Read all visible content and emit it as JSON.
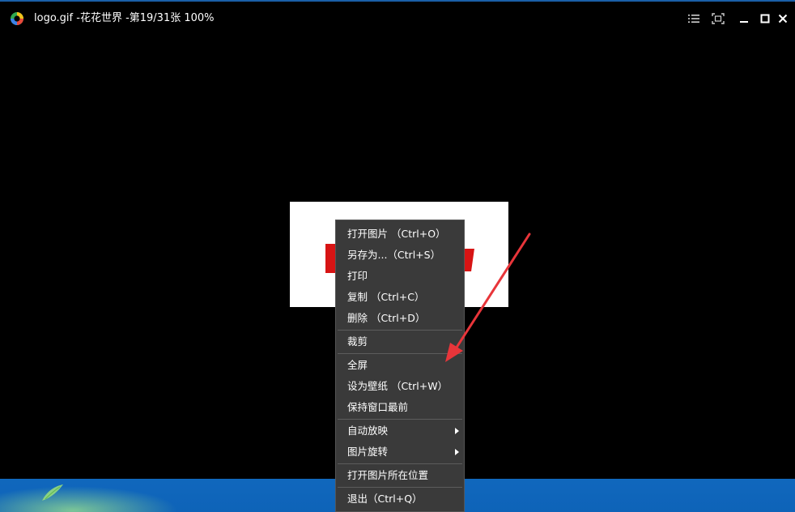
{
  "window": {
    "title": "logo.gif -花花世界 -第19/31张 100%"
  },
  "titlebar_buttons": [
    {
      "name": "menu-list-button",
      "icon": "list-icon"
    },
    {
      "name": "fit-screen-button",
      "icon": "fit-screen-icon"
    },
    {
      "name": "minimize-button",
      "icon": "minimize-icon"
    },
    {
      "name": "maximize-button",
      "icon": "maximize-icon"
    },
    {
      "name": "close-button",
      "icon": "close-icon"
    }
  ],
  "context_menu": {
    "items": [
      {
        "label": "打开图片 （Ctrl+O）"
      },
      {
        "label": "另存为...（Ctrl+S）"
      },
      {
        "label": "打印"
      },
      {
        "label": "复制 （Ctrl+C）"
      },
      {
        "label": "删除 （Ctrl+D）"
      },
      {
        "label": "裁剪"
      },
      {
        "label": "全屏"
      },
      {
        "label": "设为壁纸 （Ctrl+W）"
      },
      {
        "label": "保持窗口最前"
      },
      {
        "label": "自动放映"
      },
      {
        "label": "图片旋转"
      },
      {
        "label": "打开图片所在位置"
      },
      {
        "label": "退出（Ctrl+Q）"
      }
    ]
  },
  "colors": {
    "window_background": "#000000",
    "menu_background": "#3a3a3a",
    "menu_separator": "#5c5c5c",
    "image_accent": "#d71414",
    "annotation_arrow": "#e8353a",
    "title_text": "#ffffff"
  }
}
